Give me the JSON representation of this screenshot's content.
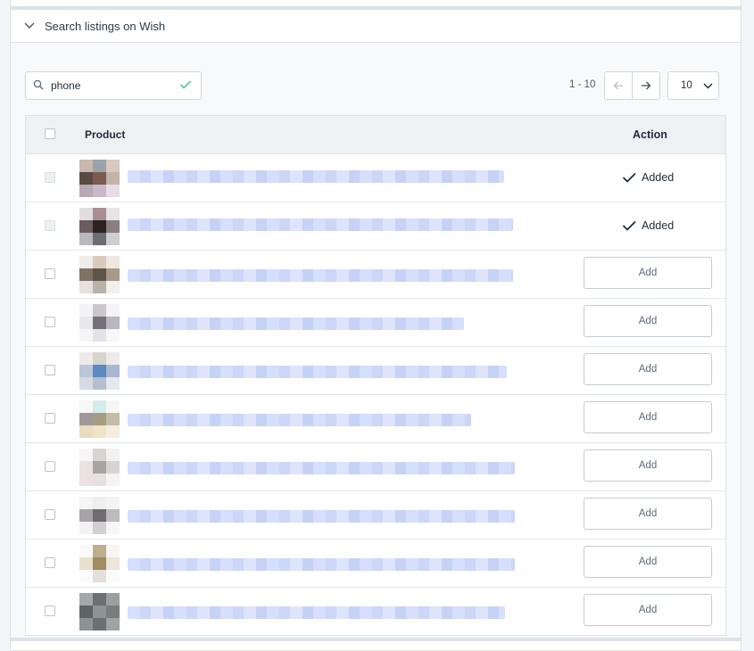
{
  "panel": {
    "title": "Search listings on Wish"
  },
  "search": {
    "value": "phone",
    "placeholder": "Search"
  },
  "pagination": {
    "range": "1 - 10",
    "per_page": "10"
  },
  "table": {
    "columns": {
      "product": "Product",
      "action": "Action"
    },
    "added_label": "Added",
    "add_label": "Add",
    "rows": [
      {
        "status": "added",
        "thumb": [
          "#c9b8b0",
          "#9aa3ad",
          "#d7c9bf",
          "#5a4a44",
          "#7b5a50",
          "#c4b3a8",
          "#b9a8b6",
          "#c7b9c8",
          "#e6dde6"
        ]
      },
      {
        "status": "added",
        "thumb": [
          "#e1dde0",
          "#a98e92",
          "#e8e3e5",
          "#6b5c5e",
          "#2a2224",
          "#8a7e80",
          "#b9b9bc",
          "#6e6e72",
          "#cfcfd2"
        ]
      },
      {
        "status": "add",
        "thumb": [
          "#f0ece8",
          "#d8cbbd",
          "#efe8e1",
          "#7f7366",
          "#5f5449",
          "#a8998a",
          "#e5e1dc",
          "#b9b2aa",
          "#f2efec"
        ]
      },
      {
        "status": "add",
        "thumb": [
          "#f4f4f6",
          "#c9c7cc",
          "#f3f2f4",
          "#e8e7ea",
          "#77707a",
          "#bab6be",
          "#f6f6f7",
          "#e3e2e5",
          "#f7f7f8"
        ]
      },
      {
        "status": "add",
        "thumb": [
          "#ecebe9",
          "#d7d3cf",
          "#ecebea",
          "#bcc6d6",
          "#5c88c4",
          "#a9b8cf",
          "#d5dbe4",
          "#b5c0ce",
          "#e5e8ec"
        ]
      },
      {
        "status": "add",
        "thumb": [
          "#f6f7f7",
          "#d5ecec",
          "#f4f6f6",
          "#9e9898",
          "#a79b84",
          "#c4bca9",
          "#e9dcc0",
          "#efe4c8",
          "#f4eee0"
        ]
      },
      {
        "status": "add",
        "thumb": [
          "#f7f5f5",
          "#d8d4d4",
          "#f2f0f0",
          "#e8e2e2",
          "#a9a3a3",
          "#d9d4d4",
          "#ede0e0",
          "#e7e0e0",
          "#f5f3f3"
        ]
      },
      {
        "status": "add",
        "thumb": [
          "#f5f5f5",
          "#eeeeee",
          "#f4f4f4",
          "#a5a3a5",
          "#6f6d70",
          "#bdbbbe",
          "#f2f2f2",
          "#d2d1d2",
          "#f6f6f6"
        ]
      },
      {
        "status": "add",
        "thumb": [
          "#fbfaf8",
          "#bfae8c",
          "#f8f6f2",
          "#e7e0cf",
          "#a08b62",
          "#ece6d9",
          "#fbfbfa",
          "#e3e0da",
          "#fbfbfa"
        ]
      },
      {
        "status": "add",
        "thumb": [
          "#a4a8a8",
          "#6a7070",
          "#9aa09f",
          "#5d6463",
          "#8e9493",
          "#777d7d",
          "#8d9393",
          "#6b7171",
          "#9ea3a3"
        ]
      }
    ]
  }
}
